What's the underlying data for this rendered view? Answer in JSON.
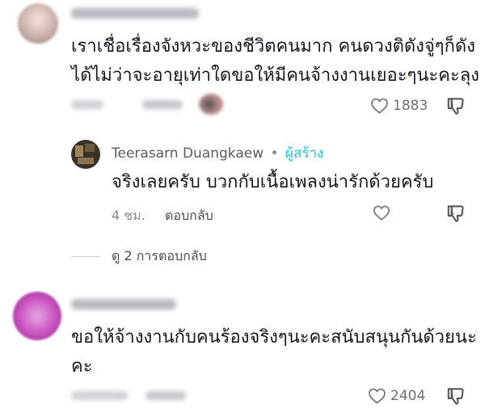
{
  "comments": [
    {
      "username": "",
      "text_line1": "เราเชื่อเรื่องจังหวะของชีวิตคนมาก คนดวงติดังจู่ๆก็ดัง",
      "text_line2": "ได้ไม่ว่าจะอายุเท่าใดขอให้มีคนจ้างงานเยอะๆนะคะลุง",
      "like_count": "1883"
    },
    {
      "username": "",
      "text_line1": "ขอให้จ้างงานกับคนร้องจริงๆนะคะสนับสนุนกันด้วยนะ",
      "text_line2": "คะ",
      "like_count": "2404"
    }
  ],
  "reply": {
    "author": "Teerasarn Duangkaew",
    "separator": "•",
    "creator_badge": "ผู้สร้าง",
    "text": "จริงเลยครับ บวกกับเนื้อเพลงน่ารักด้วยครับ",
    "time": "4 ชม.",
    "reply_label": "ตอบกลับ"
  },
  "view_replies": {
    "label": "ดู 2 การตอบกลับ"
  },
  "colors": {
    "creator_badge": "#20d5ec",
    "text": "#161823",
    "meta": "#8a8b91"
  },
  "icons": [
    "heart-icon",
    "dislike-icon"
  ]
}
